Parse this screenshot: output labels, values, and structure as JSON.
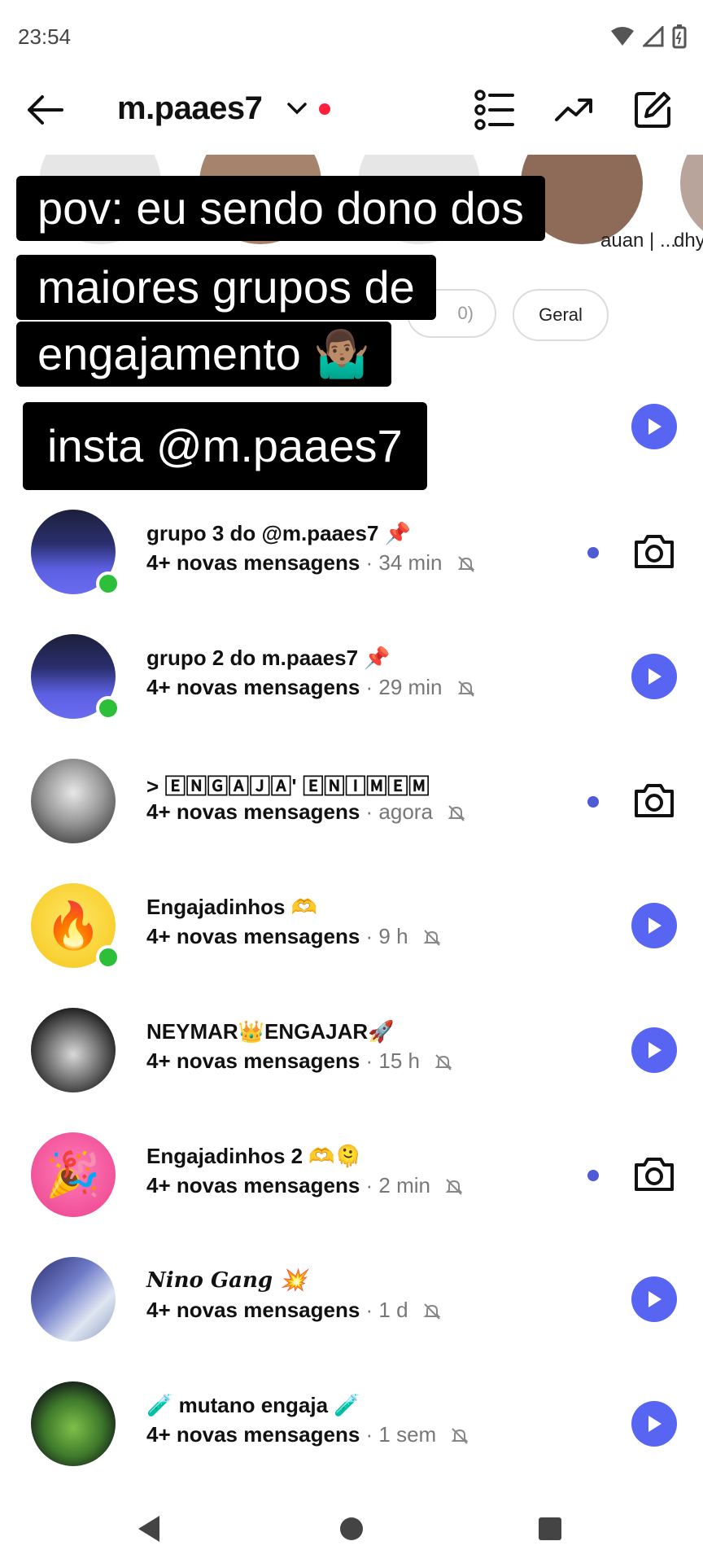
{
  "status": {
    "time": "23:54"
  },
  "header": {
    "username": "m.paaes7"
  },
  "stories": [
    {
      "name": ""
    },
    {
      "name": ""
    },
    {
      "name": ""
    },
    {
      "name": "auan | ..."
    },
    {
      "name": "dhy"
    }
  ],
  "filters": {
    "partial_chip": "0)",
    "geral_chip": "Geral"
  },
  "overlay": {
    "line1": "pov: eu sendo dono dos",
    "line2": "maiores grupos de",
    "line3": "engajamento 🤷🏽‍♂️",
    "line4": "insta @m.paaes7"
  },
  "threads": [
    {
      "title": "grupo 3 do @m.paaes7 📌",
      "new": "4+ novas mensagens",
      "time": " · 34 min",
      "action": "camera"
    },
    {
      "title": "grupo 2 do m.paaes7 📌",
      "new": "4+ novas mensagens",
      "time": " · 29 min",
      "action": "play"
    },
    {
      "title": "> 🄴🄽🄶🄰🄹🄰' 🄴🄽🄸🄼🄴🄼",
      "new": "4+ novas mensagens",
      "time": " · agora",
      "action": "camera"
    },
    {
      "title": "Engajadinhos 🫶",
      "new": "4+ novas mensagens",
      "time": " · 9 h",
      "action": "play"
    },
    {
      "title": "NEYMAR👑ENGAJAR🚀",
      "new": "4+ novas mensagens",
      "time": " · 15 h",
      "action": "play"
    },
    {
      "title": "Engajadinhos 2  🫶🫠",
      "new": "4+ novas mensagens",
      "time": " · 2 min",
      "action": "camera"
    },
    {
      "title": "𝑵𝒊𝒏𝒐 𝑮𝒂𝒏𝒈 💥",
      "new": "4+ novas mensagens",
      "time": " · 1 d",
      "action": "play"
    },
    {
      "title": "🧪 mutano engaja 🧪",
      "new": "4+ novas mensagens",
      "time": " · 1 sem",
      "action": "play"
    }
  ],
  "colors": {
    "accent": "#5865f2",
    "online": "#2dbf3a",
    "notif_dot": "#ff1f3d"
  }
}
